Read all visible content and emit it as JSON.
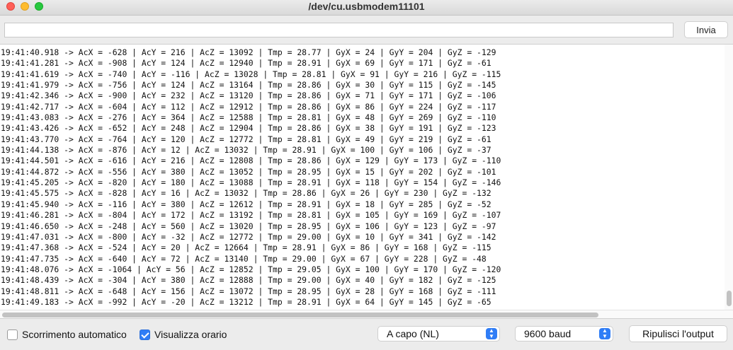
{
  "window": {
    "title": "/dev/cu.usbmodem11101"
  },
  "input": {
    "value": "",
    "placeholder": "",
    "send_label": "Invia"
  },
  "output": {
    "lines": [
      "19:41:40.918 -> AcX = -628 | AcY = 216 | AcZ = 13092 | Tmp = 28.77 | GyX = 24 | GyY = 204 | GyZ = -129",
      "19:41:41.281 -> AcX = -908 | AcY = 124 | AcZ = 12940 | Tmp = 28.91 | GyX = 69 | GyY = 171 | GyZ = -61",
      "19:41:41.619 -> AcX = -740 | AcY = -116 | AcZ = 13028 | Tmp = 28.81 | GyX = 91 | GyY = 216 | GyZ = -115",
      "19:41:41.979 -> AcX = -756 | AcY = 124 | AcZ = 13164 | Tmp = 28.86 | GyX = 30 | GyY = 115 | GyZ = -145",
      "19:41:42.346 -> AcX = -900 | AcY = 232 | AcZ = 13120 | Tmp = 28.86 | GyX = 71 | GyY = 171 | GyZ = -106",
      "19:41:42.717 -> AcX = -604 | AcY = 112 | AcZ = 12912 | Tmp = 28.86 | GyX = 86 | GyY = 224 | GyZ = -117",
      "19:41:43.083 -> AcX = -276 | AcY = 364 | AcZ = 12588 | Tmp = 28.81 | GyX = 48 | GyY = 269 | GyZ = -110",
      "19:41:43.426 -> AcX = -652 | AcY = 248 | AcZ = 12904 | Tmp = 28.86 | GyX = 38 | GyY = 191 | GyZ = -123",
      "19:41:43.770 -> AcX = -764 | AcY = 120 | AcZ = 12772 | Tmp = 28.81 | GyX = 49 | GyY = 219 | GyZ = -61",
      "19:41:44.138 -> AcX = -876 | AcY = 12 | AcZ = 13032 | Tmp = 28.91 | GyX = 100 | GyY = 106 | GyZ = -37",
      "19:41:44.501 -> AcX = -616 | AcY = 216 | AcZ = 12808 | Tmp = 28.86 | GyX = 129 | GyY = 173 | GyZ = -110",
      "19:41:44.872 -> AcX = -556 | AcY = 380 | AcZ = 13052 | Tmp = 28.95 | GyX = 15 | GyY = 202 | GyZ = -101",
      "19:41:45.205 -> AcX = -820 | AcY = 180 | AcZ = 13088 | Tmp = 28.91 | GyX = 118 | GyY = 154 | GyZ = -146",
      "19:41:45.575 -> AcX = -828 | AcY = 16 | AcZ = 13032 | Tmp = 28.86 | GyX = 26 | GyY = 230 | GyZ = -132",
      "19:41:45.940 -> AcX = -116 | AcY = 380 | AcZ = 12612 | Tmp = 28.91 | GyX = 18 | GyY = 285 | GyZ = -52",
      "19:41:46.281 -> AcX = -804 | AcY = 172 | AcZ = 13192 | Tmp = 28.81 | GyX = 105 | GyY = 169 | GyZ = -107",
      "19:41:46.650 -> AcX = -248 | AcY = 560 | AcZ = 13020 | Tmp = 28.95 | GyX = 106 | GyY = 123 | GyZ = -97",
      "19:41:47.031 -> AcX = -800 | AcY = -32 | AcZ = 12772 | Tmp = 29.00 | GyX = 10 | GyY = 341 | GyZ = -142",
      "19:41:47.368 -> AcX = -524 | AcY = 20 | AcZ = 12664 | Tmp = 28.91 | GyX = 86 | GyY = 168 | GyZ = -115",
      "19:41:47.735 -> AcX = -640 | AcY = 72 | AcZ = 13140 | Tmp = 29.00 | GyX = 67 | GyY = 228 | GyZ = -48",
      "19:41:48.076 -> AcX = -1064 | AcY = 56 | AcZ = 12852 | Tmp = 29.05 | GyX = 100 | GyY = 170 | GyZ = -120",
      "19:41:48.439 -> AcX = -304 | AcY = 380 | AcZ = 12888 | Tmp = 29.00 | GyX = 40 | GyY = 182 | GyZ = -125",
      "19:41:48.811 -> AcX = -648 | AcY = 156 | AcZ = 13072 | Tmp = 28.95 | GyX = 28 | GyY = 168 | GyZ = -111",
      "19:41:49.183 -> AcX = -992 | AcY = -20 | AcZ = 13212 | Tmp = 28.91 | GyX = 64 | GyY = 145 | GyZ = -65"
    ]
  },
  "bottom": {
    "autoscroll_label": "Scorrimento automatico",
    "autoscroll_checked": false,
    "timestamp_label": "Visualizza orario",
    "timestamp_checked": true,
    "line_ending_value": "A capo (NL)",
    "baud_value": "9600 baud",
    "clear_label": "Ripulisci l'output"
  },
  "colors": {
    "accent": "#2f7df6",
    "close": "#ff5f57",
    "minimize": "#febc2e",
    "maximize": "#28c840"
  },
  "icons": [
    "close-icon",
    "minimize-icon",
    "maximize-icon",
    "checkmark-icon",
    "chevron-updown-icon"
  ]
}
